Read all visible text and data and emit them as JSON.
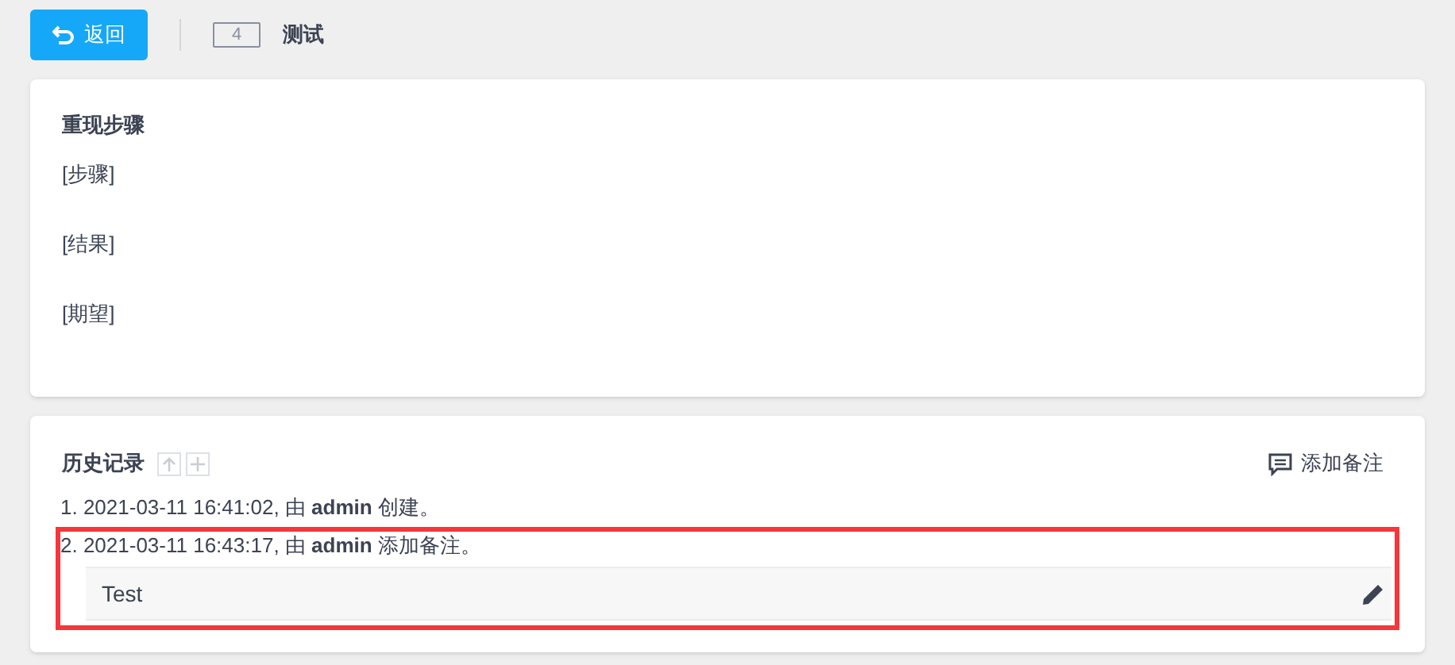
{
  "header": {
    "back_button": "返回",
    "id_badge": "4",
    "title": "测试"
  },
  "steps_card": {
    "heading": "重现步骤",
    "lines": [
      "[步骤]",
      "[结果]",
      "[期望]"
    ]
  },
  "history": {
    "heading": "历史记录",
    "add_note": "添加备注",
    "items": [
      {
        "text": "1. 2021-03-11 16:41:02, 由 **admin** 创建。",
        "highlighted": false
      },
      {
        "text": "2. 2021-03-11 16:43:17, 由 **admin** 添加备注。",
        "comment": "Test",
        "highlighted": true
      }
    ]
  }
}
